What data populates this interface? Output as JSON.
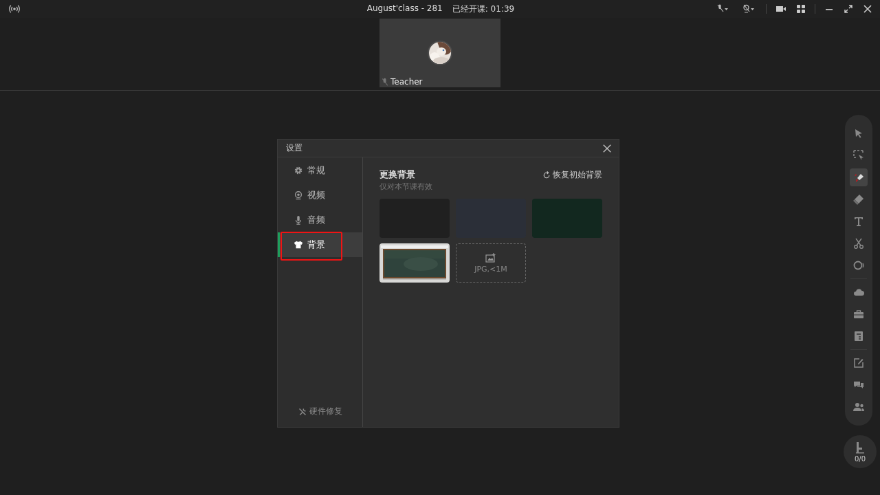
{
  "top_bar": {
    "title": "August'class - 281",
    "timer": "已经开课: 01:39"
  },
  "video_tile": {
    "name": "Teacher",
    "muted": true,
    "avatar": {
      "kind": "picture"
    }
  },
  "dialog": {
    "title": "设置",
    "nav": [
      {
        "label": "常规",
        "selected": false,
        "highlighted": false
      },
      {
        "label": "视频",
        "selected": false,
        "highlighted": false
      },
      {
        "label": "音频",
        "selected": false,
        "highlighted": false
      },
      {
        "label": "背景",
        "selected": true,
        "highlighted": true
      }
    ],
    "footer_link": "硬件修复",
    "heading": "更换背景",
    "subheading": "仅对本节课有效",
    "reset": "恢复初始背景",
    "backgrounds": [
      {
        "kind": "color",
        "color": "#202020"
      },
      {
        "kind": "color",
        "color": "#2b2f38"
      },
      {
        "kind": "color",
        "color": "#12281f"
      },
      {
        "kind": "picture"
      },
      {
        "kind": "upload",
        "label": "JPG,<1M"
      }
    ]
  },
  "tool_groups": [
    [
      {
        "kind": "pointer",
        "selected": false
      },
      {
        "kind": "select",
        "selected": false
      },
      {
        "kind": "pen",
        "selected": true
      },
      {
        "kind": "eraser",
        "selected": false
      },
      {
        "kind": "text",
        "selected": false
      },
      {
        "kind": "scissors",
        "selected": false
      },
      {
        "kind": "shape",
        "selected": false
      }
    ],
    [
      {
        "kind": "cloud",
        "selected": false
      },
      {
        "kind": "toolbox",
        "selected": false
      },
      {
        "kind": "notes",
        "selected": false
      }
    ],
    [
      {
        "kind": "edit",
        "selected": false
      },
      {
        "kind": "chat",
        "selected": false
      },
      {
        "kind": "users",
        "selected": false
      }
    ]
  ],
  "hand_raise": {
    "count": "0/0"
  }
}
